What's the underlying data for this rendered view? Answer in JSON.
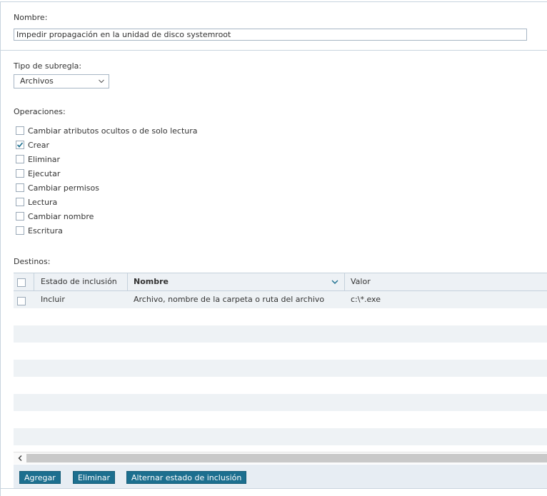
{
  "form": {
    "name_label": "Nombre:",
    "name_value": "Impedir propagación en la unidad de disco systemroot",
    "subrule_label": "Tipo de subregla:",
    "subrule_value": "Archivos",
    "operations_label": "Operaciones:",
    "targets_label": "Destinos:"
  },
  "operations": [
    {
      "label": "Cambiar atributos ocultos o de solo lectura",
      "checked": false
    },
    {
      "label": "Crear",
      "checked": true
    },
    {
      "label": "Eliminar",
      "checked": false
    },
    {
      "label": "Ejecutar",
      "checked": false
    },
    {
      "label": "Cambiar permisos",
      "checked": false
    },
    {
      "label": "Lectura",
      "checked": false
    },
    {
      "label": "Cambiar nombre",
      "checked": false
    },
    {
      "label": "Escritura",
      "checked": false
    }
  ],
  "grid": {
    "columns": [
      "Estado de inclusión",
      "Nombre",
      "Valor"
    ],
    "rows": [
      {
        "estado": "Incluir",
        "nombre": "Archivo, nombre de la carpeta o ruta del archivo",
        "valor": "c:\\*.exe"
      }
    ]
  },
  "buttons": {
    "add": "Agregar",
    "remove": "Eliminar",
    "toggle": "Alternar estado de inclusión"
  },
  "colors": {
    "accent": "#1c6f8f",
    "header_bg": "#edf1f5",
    "row_alt": "#eef2f5"
  }
}
